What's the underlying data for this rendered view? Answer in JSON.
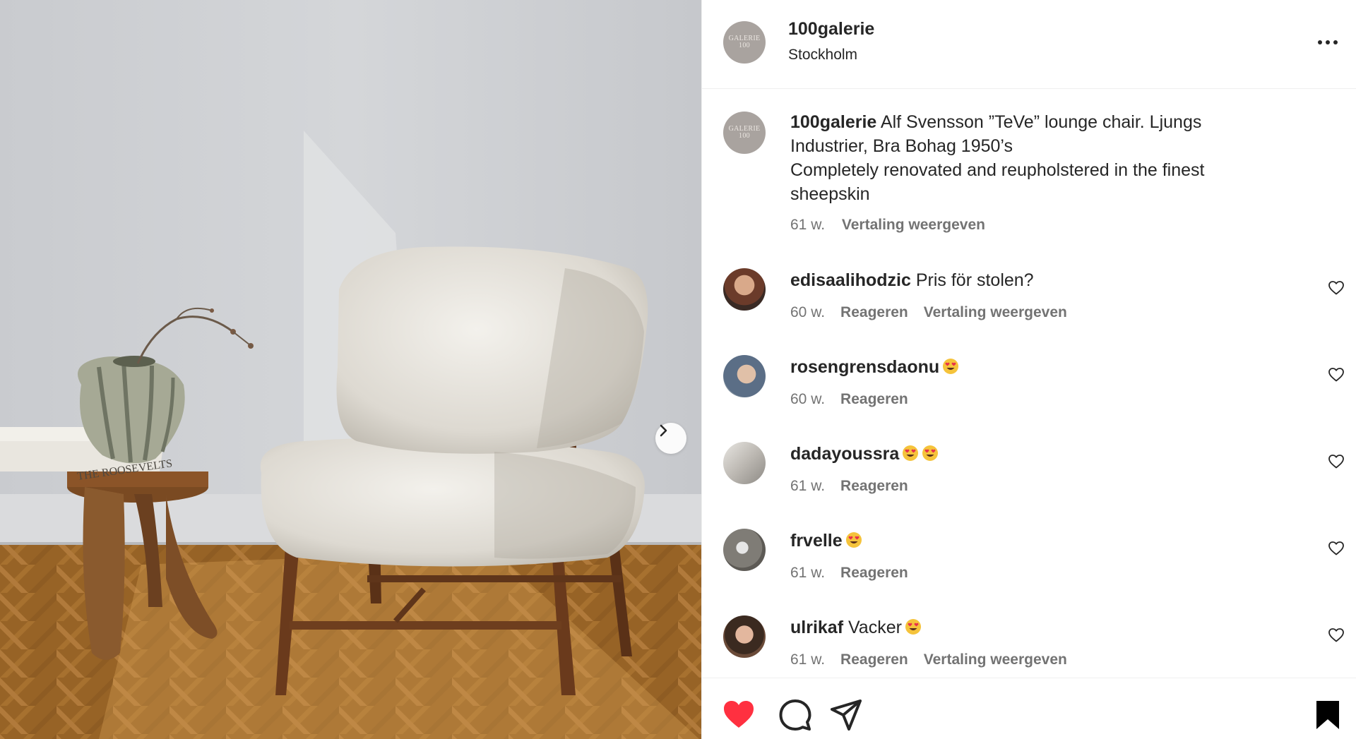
{
  "post": {
    "username": "100galerie",
    "location": "Stockholm",
    "avatar_text_line1": "GALERIE",
    "avatar_text_line2": "100"
  },
  "caption": {
    "username": "100galerie",
    "text_line1": "Alf Svensson ”TeVe” lounge chair. Ljungs Industrier, Bra Bohag 1950’s",
    "text_line2": "Completely renovated and reupholstered in the finest sheepskin",
    "time": "61 w.",
    "translate": "Vertaling weergeven"
  },
  "comments": [
    {
      "username": "edisaalihodzic",
      "text": "Pris för stolen?",
      "emoji_count": 0,
      "time": "60 w.",
      "reply": "Reageren",
      "translate": "Vertaling weergeven"
    },
    {
      "username": "rosengrensdaonu",
      "text": "",
      "emoji_count": 1,
      "time": "60 w.",
      "reply": "Reageren",
      "translate": ""
    },
    {
      "username": "dadayoussra",
      "text": "",
      "emoji_count": 2,
      "time": "61 w.",
      "reply": "Reageren",
      "translate": ""
    },
    {
      "username": "frvelle",
      "text": "",
      "emoji_count": 1,
      "time": "61 w.",
      "reply": "Reageren",
      "translate": ""
    },
    {
      "username": "ulrikaf",
      "text": "Vacker",
      "emoji_count": 1,
      "time": "61 w.",
      "reply": "Reageren",
      "translate": "Vertaling weergeven"
    }
  ],
  "photo": {
    "book_title": "THE ROOSEVELTS",
    "book_spine": "ROOSEVELTS"
  },
  "icons": {
    "more": "more-horizontal-icon",
    "next": "chevron-right-icon",
    "like": "heart-filled-icon",
    "comment": "comment-icon",
    "share": "send-icon",
    "save": "bookmark-filled-icon",
    "comment_like": "heart-outline-icon",
    "emoji": "heart-eyes-emoji-icon"
  },
  "colors": {
    "like_red": "#ff3040",
    "text": "#262626",
    "secondary_text": "#737373",
    "divider": "#efefef"
  }
}
